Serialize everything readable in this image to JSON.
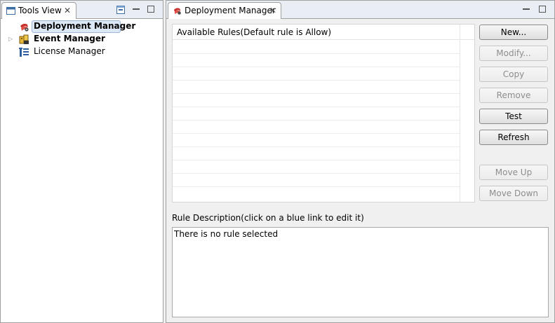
{
  "tools_view": {
    "tab_title": "Tools View",
    "tab_icon": "tools-view-icon",
    "close_glyph": "✕",
    "tree": [
      {
        "label": "Deployment Manager",
        "icon": "deployment-manager-icon",
        "selected": true,
        "bold": true,
        "expandable": false
      },
      {
        "label": "Event Manager",
        "icon": "event-manager-icon",
        "selected": false,
        "bold": true,
        "expandable": true,
        "expander_glyph": "▷"
      },
      {
        "label": "License Manager",
        "icon": "license-manager-icon",
        "selected": false,
        "bold": false,
        "expandable": false
      }
    ]
  },
  "deployment_manager": {
    "tab_title": "Deployment Manager",
    "tab_icon": "deployment-manager-icon",
    "close_glyph": "✕",
    "rules_table": {
      "header": "Available Rules(Default rule is Allow)",
      "rows": []
    },
    "buttons": [
      {
        "label": "New...",
        "enabled": true
      },
      {
        "label": "Modify...",
        "enabled": false
      },
      {
        "label": "Copy",
        "enabled": false
      },
      {
        "label": "Remove",
        "enabled": false
      },
      {
        "label": "Test",
        "enabled": true
      },
      {
        "label": "Refresh",
        "enabled": true
      },
      {
        "label": "Move Up",
        "enabled": false
      },
      {
        "label": "Move Down",
        "enabled": false
      }
    ],
    "rule_description": {
      "label": "Rule Description(click on a blue link to edit it)",
      "text": "There is no rule selected"
    }
  },
  "colors": {
    "selection_bg": "#dce8f6",
    "selection_border": "#9bb6d9",
    "disabled_text": "#8d8d8d",
    "tabbar_bg": "#e9eef5"
  }
}
